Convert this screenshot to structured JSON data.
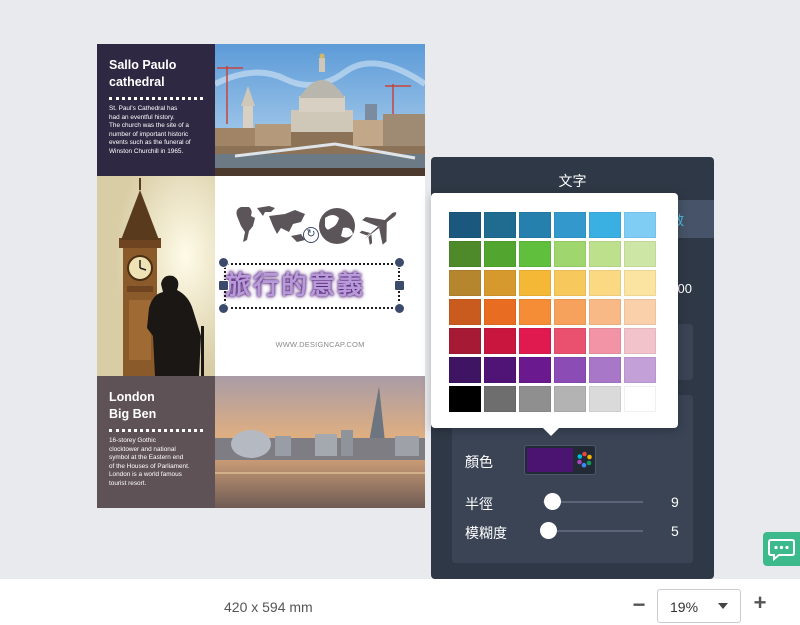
{
  "poster": {
    "top_left": {
      "title": "Sallo Paulo\ncathedral",
      "body": "St. Paul's Cathedral has\nhad an eventful history.\nThe church was the site of a\nnumber of important historic\nevents such as  the funeral of\nWinston Churchill in 1965."
    },
    "bottom_left": {
      "title": "London\nBig Ben",
      "body": "16-storey Gothic\nclocktower and national\nsymbol at the Eastern end\nof the Houses of Parliament.\nLondon is a world famous\ntourist resort."
    },
    "center": {
      "title_text": "旅行的意義",
      "url": "WWW.DESIGNCAP.COM"
    },
    "icons": [
      "world-map-icon",
      "globe-icon",
      "airplane-icon",
      "rotate-icon"
    ]
  },
  "text_panel": {
    "title": "文字",
    "tab_glyph": "效",
    "side_value": "00",
    "color_label": "顏色",
    "selected_color": "#4a1470",
    "radius_label": "半徑",
    "radius_value": "9",
    "radius_level": 0.09,
    "blur_label": "模糊度",
    "blur_value": "5",
    "blur_level": 0.05,
    "icons": [
      "palette-icon"
    ]
  },
  "color_picker": {
    "rows": [
      [
        "#1a587d",
        "#1f6c90",
        "#2680ad",
        "#3399cc",
        "#3ab0e2",
        "#7fcdf4"
      ],
      [
        "#4f8a2a",
        "#52a62f",
        "#60bf3d",
        "#9fd66d",
        "#bde08d",
        "#cde6a6"
      ],
      [
        "#b6862f",
        "#d5992d",
        "#f4b736",
        "#f7c95d",
        "#fbd882",
        "#fbe3a1"
      ],
      [
        "#c95b1f",
        "#e86c21",
        "#f48d36",
        "#f7a25c",
        "#f9b986",
        "#fad0ab"
      ],
      [
        "#a71a35",
        "#c8163f",
        "#e01a4f",
        "#e9516f",
        "#f294a6",
        "#f3c3cc"
      ],
      [
        "#3f1462",
        "#501476",
        "#6a1a8e",
        "#8c4cb6",
        "#a877c7",
        "#c4a0d9"
      ],
      [
        "#000000",
        "#6e6e6e",
        "#8f8f8f",
        "#b3b3b3",
        "#dadada",
        "#ffffff"
      ]
    ]
  },
  "chat": {
    "icon": "chat-icon"
  },
  "bottom_bar": {
    "page_size": "420 x 594 mm",
    "zoom_minus": "−",
    "zoom_value": "19%",
    "zoom_plus": "+"
  }
}
